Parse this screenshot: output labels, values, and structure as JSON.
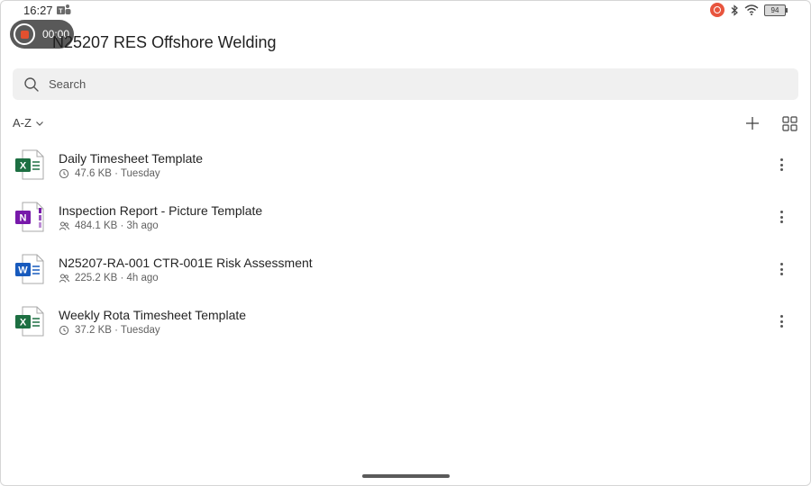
{
  "status_bar": {
    "time": "16:27",
    "battery": "94",
    "icons": [
      "teams-icon",
      "screen-record-icon",
      "bluetooth-icon",
      "wifi-icon",
      "battery-icon"
    ]
  },
  "recording": {
    "timer": "00:00"
  },
  "header": {
    "title": "N25207 RES Offshore Welding"
  },
  "search": {
    "placeholder": "Search"
  },
  "toolbar": {
    "sort_label": "A-Z"
  },
  "colors": {
    "excel": "#1d6f42",
    "onenote": "#7719aa",
    "word": "#185abd",
    "recording_red": "#e2502f"
  },
  "files": [
    {
      "name": "Daily Timesheet Template",
      "meta": "47.6 KB · Tuesday",
      "type": "excel",
      "meta_icon": "history-icon"
    },
    {
      "name": "Inspection Report - Picture Template",
      "meta": "484.1 KB · 3h ago",
      "type": "onenote",
      "meta_icon": "shared-people-icon"
    },
    {
      "name": "N25207-RA-001 CTR-001E Risk Assessment",
      "meta": "225.2 KB · 4h ago",
      "type": "word",
      "meta_icon": "shared-people-icon"
    },
    {
      "name": "Weekly Rota Timesheet Template",
      "meta": "37.2 KB · Tuesday",
      "type": "excel",
      "meta_icon": "history-icon"
    }
  ]
}
